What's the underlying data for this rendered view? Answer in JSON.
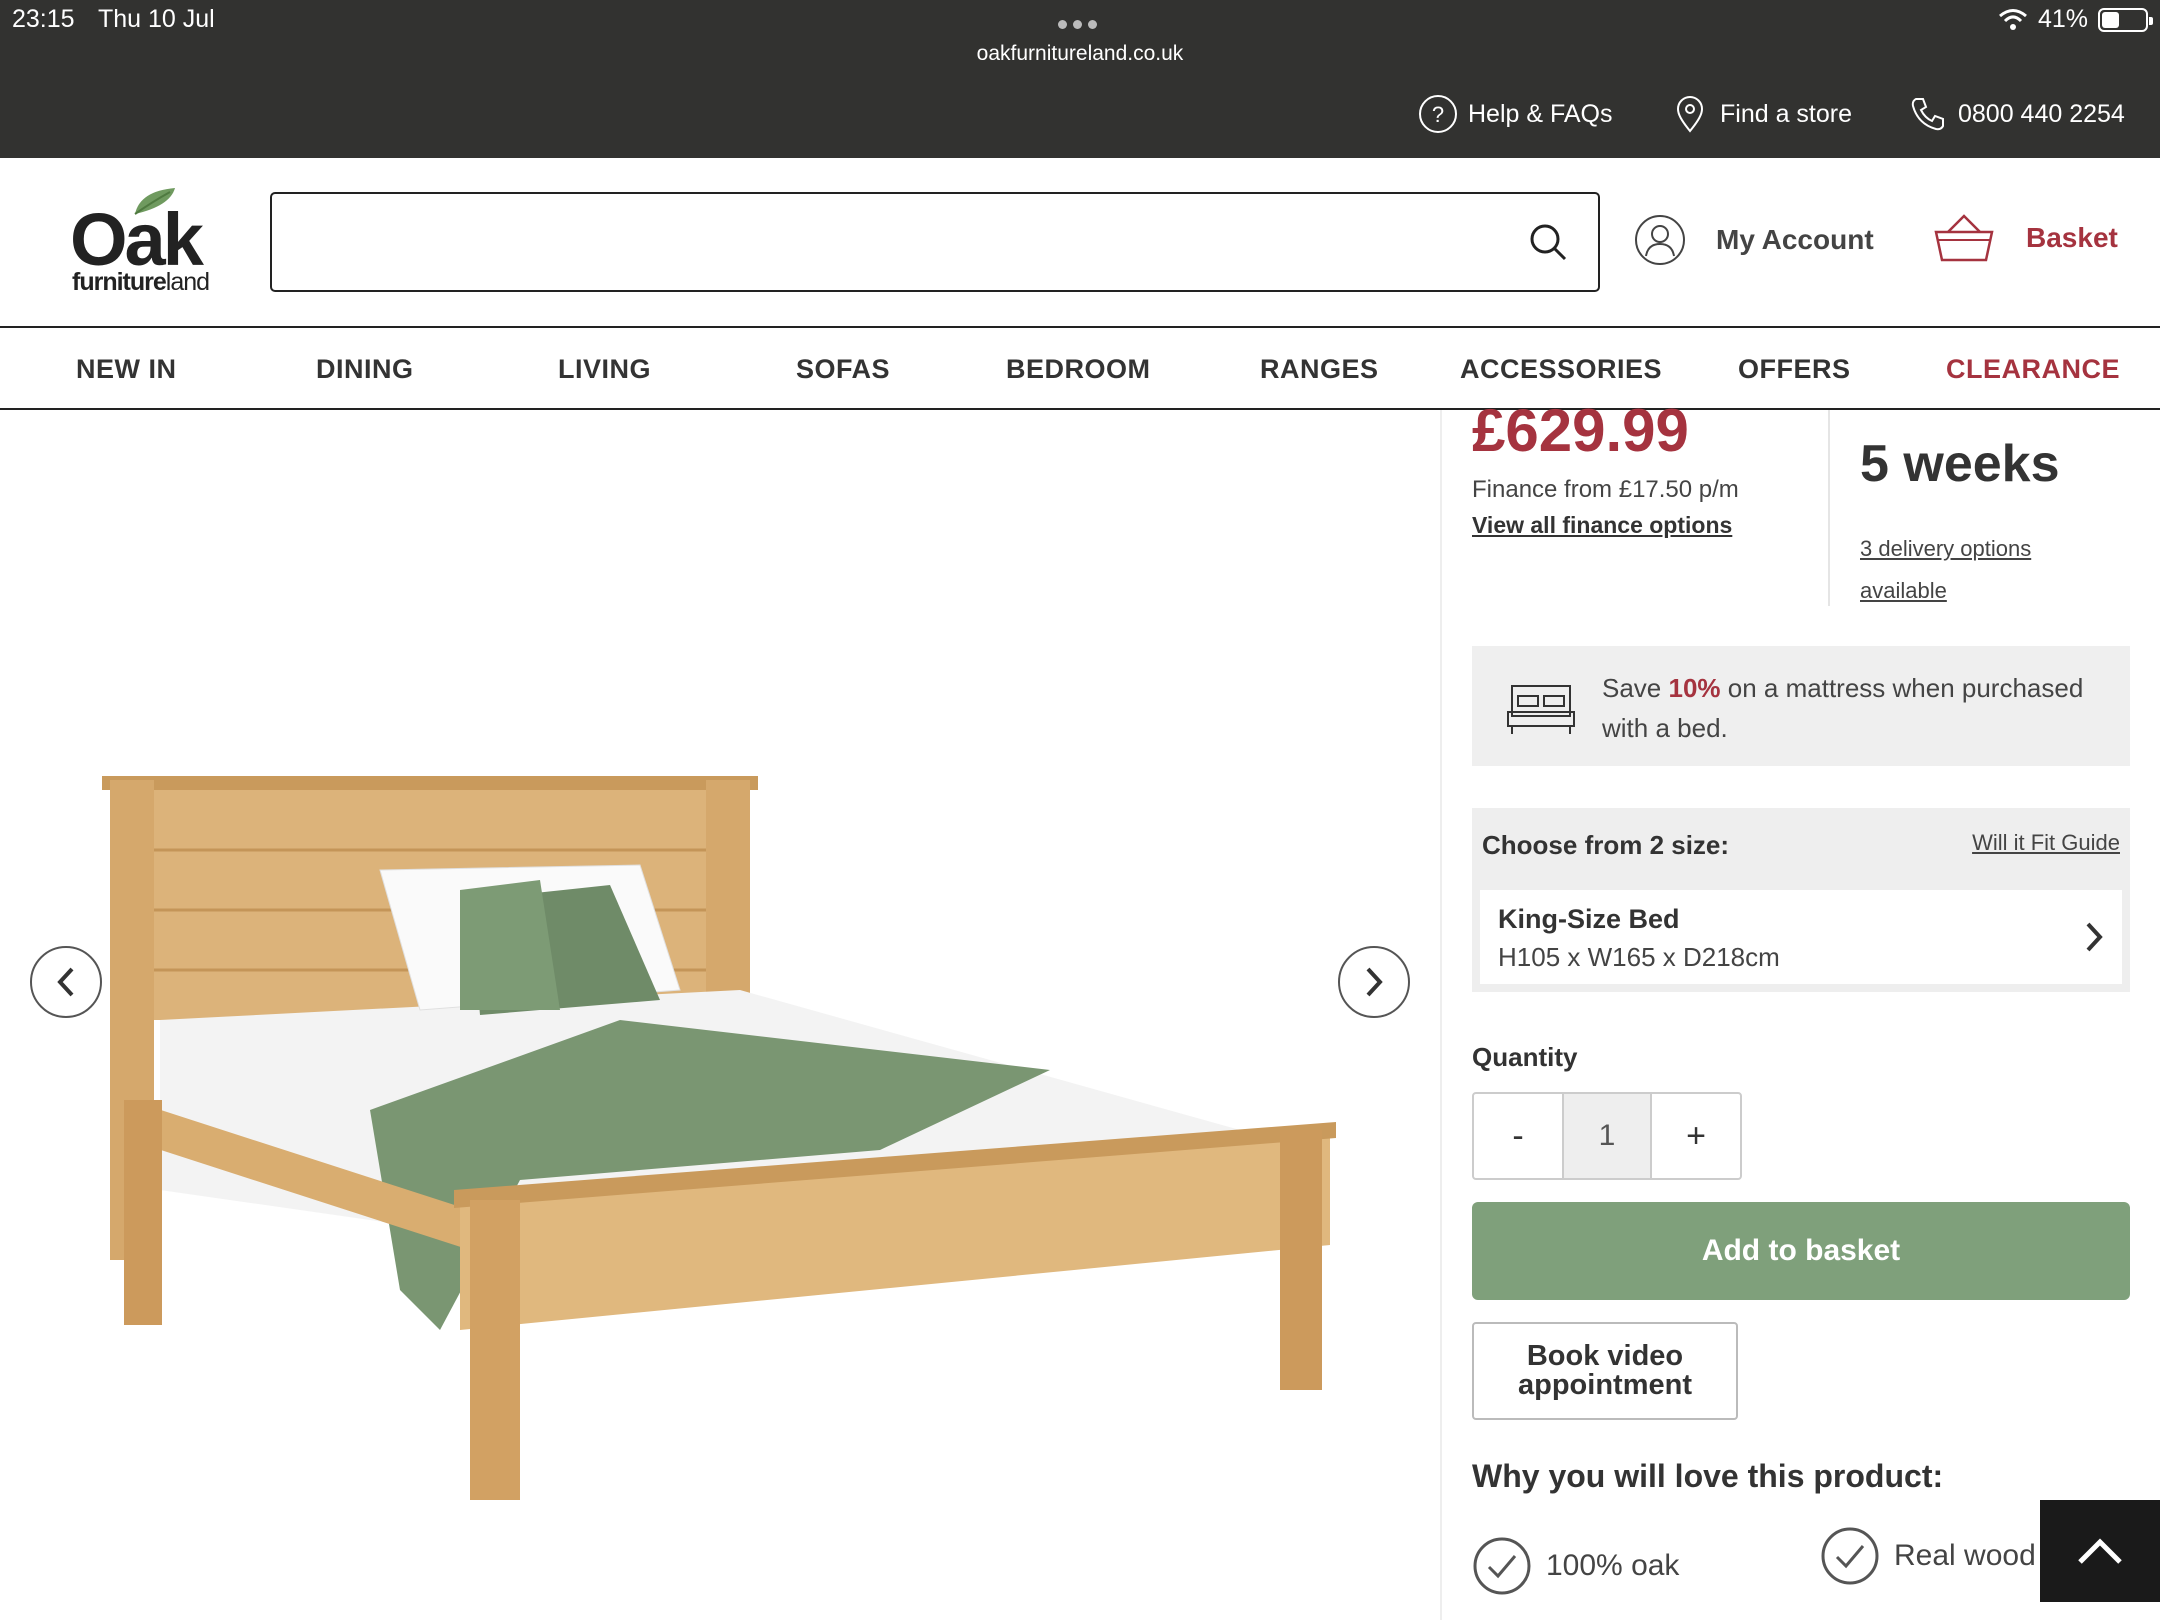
{
  "status_bar": {
    "time": "23:15",
    "date": "Thu 10 Jul",
    "url": "oakfurnitureland.co.uk",
    "battery": "41%",
    "battery_level": 0.41
  },
  "utility_links": {
    "help": "Help & FAQs",
    "store": "Find a store",
    "phone": "0800 440 2254"
  },
  "header": {
    "logo_main": "Oak",
    "logo_sub_bold": "furniture",
    "logo_sub": "land",
    "search_value": "",
    "account_label": "My Account",
    "basket_label": "Basket"
  },
  "nav": [
    "NEW IN",
    "DINING",
    "LIVING",
    "SOFAS",
    "BEDROOM",
    "RANGES",
    "ACCESSORIES",
    "OFFERS",
    "CLEARANCE"
  ],
  "product": {
    "price": "£629.99",
    "finance_text": "Finance from £17.50 p/m",
    "finance_link": "View all finance options",
    "delivery_time": "5 weeks",
    "delivery_link": "3 delivery options available",
    "promo_pre": "Save ",
    "promo_pct": "10%",
    "promo_post": " on a mattress when purchased with a bed.",
    "size_heading": "Choose from 2 size:",
    "size_guide": "Will it Fit Guide",
    "size_name": "King-Size Bed",
    "size_dims": "H105 x W165 x D218cm",
    "quantity_label": "Quantity",
    "qty_minus": "-",
    "quantity": "1",
    "qty_plus": "+",
    "add_to_basket": "Add to basket",
    "book_video": "Book video appointment",
    "why_heading": "Why you will love this product:",
    "feature_1": "100% oak",
    "feature_2": "Real wood to bottom"
  },
  "colors": {
    "accent_red": "#a5333f",
    "green_button": "#7fa07b",
    "dark_bar": "#323230"
  },
  "icons": [
    "help-icon",
    "location-pin-icon",
    "phone-icon",
    "search-icon",
    "user-icon",
    "basket-icon",
    "chevron-left-icon",
    "chevron-right-icon",
    "bed-icon",
    "check-circle-icon",
    "arrow-up-icon"
  ]
}
